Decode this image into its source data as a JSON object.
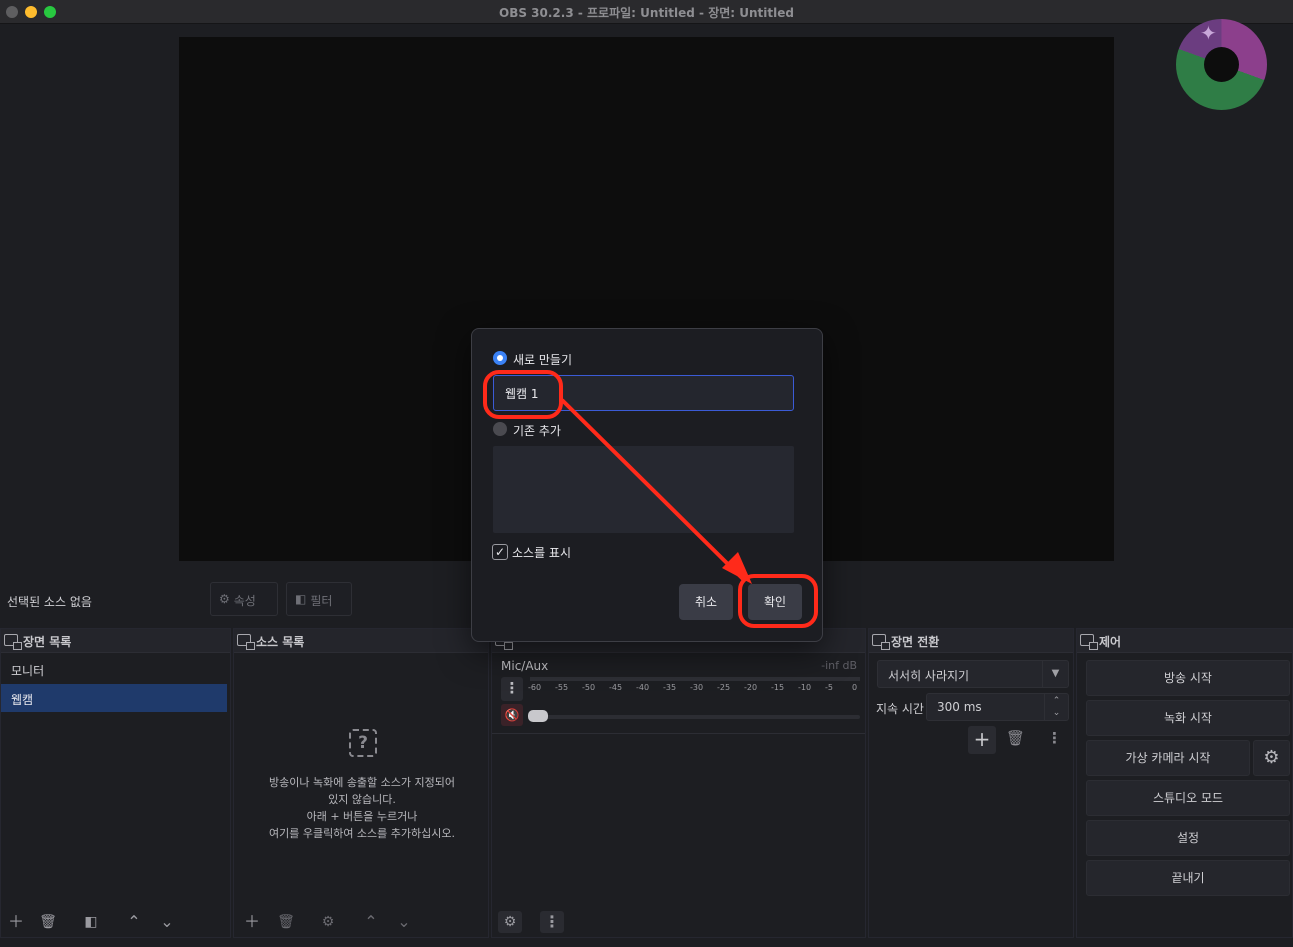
{
  "window": {
    "title": "OBS 30.2.3 - 프로파일: Untitled - 장면: Untitled"
  },
  "context_bar": {
    "no_source": "선택된 소스 없음",
    "properties": "속성",
    "filters": "필터"
  },
  "scenes": {
    "title": "장면 목록",
    "items": [
      {
        "label": "모니터"
      },
      {
        "label": "웹캠"
      }
    ]
  },
  "sources": {
    "title": "소스 목록",
    "empty_line1": "방송이나 녹화에 송출할 소스가 지정되어",
    "empty_line2": "있지 않습니다.",
    "empty_line3": "아래 + 버튼을 누르거나",
    "empty_line4": "여기를 우클릭하여 소스를 추가하십시오."
  },
  "mixer": {
    "track_name": "Mic/Aux",
    "level": "-inf dB",
    "scale": [
      "-60",
      "-55",
      "-50",
      "-45",
      "-40",
      "-35",
      "-30",
      "-25",
      "-20",
      "-15",
      "-10",
      "-5",
      "0"
    ]
  },
  "transitions": {
    "title": "장면 전환",
    "selected": "서서히 사라지기",
    "duration_label": "지속 시간",
    "duration_value": "300 ms"
  },
  "controls": {
    "title": "제어",
    "start_streaming": "방송 시작",
    "start_recording": "녹화 시작",
    "start_virtual_camera": "가상 카메라 시작",
    "studio_mode": "스튜디오 모드",
    "settings": "설정",
    "exit": "끝내기"
  },
  "dialog": {
    "create_new": "새로 만들기",
    "source_name": "웹캠 1",
    "add_existing": "기존 추가",
    "make_visible": "소스를 표시",
    "cancel": "취소",
    "ok": "확인"
  },
  "colors": {
    "accent": "#3b82f6",
    "selection": "#1f3a6b",
    "annotation": "#ff2a1a"
  }
}
